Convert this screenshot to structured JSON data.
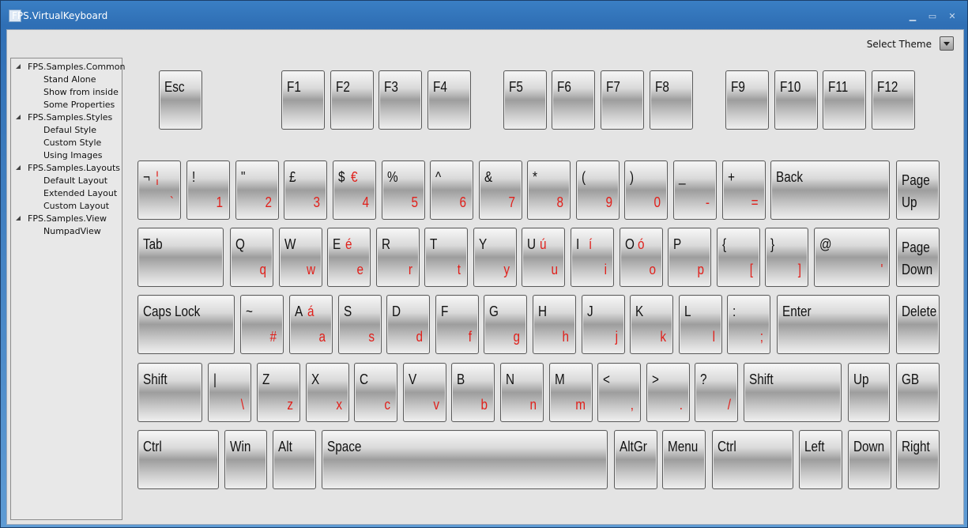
{
  "window": {
    "title": "FPS.VirtualKeyboard",
    "controls": [
      "minimize",
      "maximize",
      "close"
    ]
  },
  "theme": {
    "label": "Select Theme"
  },
  "tree": [
    {
      "header": "FPS.Samples.Common",
      "items": [
        "Stand Alone",
        "Show from inside",
        "Some Properties"
      ]
    },
    {
      "header": "FPS.Samples.Styles",
      "items": [
        "Defaul Style",
        "Custom Style",
        "Using Images"
      ]
    },
    {
      "header": "FPS.Samples.Layouts",
      "items": [
        "Default Layout",
        "Extended Layout",
        "Custom Layout"
      ]
    },
    {
      "header": "FPS.Samples.View",
      "items": [
        "NumpadView"
      ]
    }
  ],
  "keys": {
    "esc": "Esc",
    "f1": "F1",
    "f2": "F2",
    "f3": "F3",
    "f4": "F4",
    "f5": "F5",
    "f6": "F6",
    "f7": "F7",
    "f8": "F8",
    "f9": "F9",
    "f10": "F10",
    "f11": "F11",
    "f12": "F12",
    "row1": [
      {
        "top": "¬",
        "alt": "¦",
        "bot": "`"
      },
      {
        "top": "!",
        "bot": "1"
      },
      {
        "top": "\"",
        "bot": "2"
      },
      {
        "top": "£",
        "bot": "3"
      },
      {
        "top": "$",
        "alt": "€",
        "bot": "4"
      },
      {
        "top": "%",
        "bot": "5"
      },
      {
        "top": "^",
        "bot": "6"
      },
      {
        "top": "&",
        "bot": "7"
      },
      {
        "top": "*",
        "bot": "8"
      },
      {
        "top": "(",
        "bot": "9"
      },
      {
        "top": ")",
        "bot": "0"
      },
      {
        "top": "_",
        "bot": "-"
      },
      {
        "top": "+",
        "bot": "="
      }
    ],
    "back": "Back",
    "page_up_1": "Page",
    "page_up_2": "Up",
    "tab": "Tab",
    "row2": [
      {
        "top": "Q",
        "bot": "q"
      },
      {
        "top": "W",
        "bot": "w"
      },
      {
        "top": "E",
        "alt": "é",
        "bot": "e"
      },
      {
        "top": "R",
        "bot": "r"
      },
      {
        "top": "T",
        "bot": "t"
      },
      {
        "top": "Y",
        "bot": "y"
      },
      {
        "top": "U",
        "alt": "ú",
        "bot": "u"
      },
      {
        "top": "I",
        "alt": "í",
        "bot": "i"
      },
      {
        "top": "O",
        "alt": "ó",
        "bot": "o"
      },
      {
        "top": "P",
        "bot": "p"
      },
      {
        "top": "{",
        "bot": "["
      },
      {
        "top": "}",
        "bot": "]"
      }
    ],
    "at_top": "@",
    "at_bot": "'",
    "page_down_1": "Page",
    "page_down_2": "Down",
    "caps": "Caps Lock",
    "row3": [
      {
        "top": "~",
        "bot": "#"
      },
      {
        "top": "A",
        "alt": "á",
        "bot": "a"
      },
      {
        "top": "S",
        "bot": "s"
      },
      {
        "top": "D",
        "bot": "d"
      },
      {
        "top": "F",
        "bot": "f"
      },
      {
        "top": "G",
        "bot": "g"
      },
      {
        "top": "H",
        "bot": "h"
      },
      {
        "top": "J",
        "bot": "j"
      },
      {
        "top": "K",
        "bot": "k"
      },
      {
        "top": "L",
        "bot": "l"
      },
      {
        "top": ":",
        "bot": ";"
      }
    ],
    "enter": "Enter",
    "delete": "Delete",
    "shift_left": "Shift",
    "row4": [
      {
        "top": "|",
        "bot": "\\"
      },
      {
        "top": "Z",
        "bot": "z"
      },
      {
        "top": "X",
        "bot": "x"
      },
      {
        "top": "C",
        "bot": "c"
      },
      {
        "top": "V",
        "bot": "v"
      },
      {
        "top": "B",
        "bot": "b"
      },
      {
        "top": "N",
        "bot": "n"
      },
      {
        "top": "M",
        "bot": "m"
      },
      {
        "top": "<",
        "bot": ","
      },
      {
        "top": ">",
        "bot": "."
      },
      {
        "top": "?",
        "bot": "/"
      }
    ],
    "shift_right": "Shift",
    "up": "Up",
    "gb": "GB",
    "ctrl_left": "Ctrl",
    "win": "Win",
    "alt": "Alt",
    "space": "Space",
    "altgr": "AltGr",
    "menu": "Menu",
    "ctrl_right": "Ctrl",
    "left": "Left",
    "down": "Down",
    "right": "Right"
  },
  "colors": {
    "shift_char": "#e0201b",
    "key_text": "#111111"
  }
}
